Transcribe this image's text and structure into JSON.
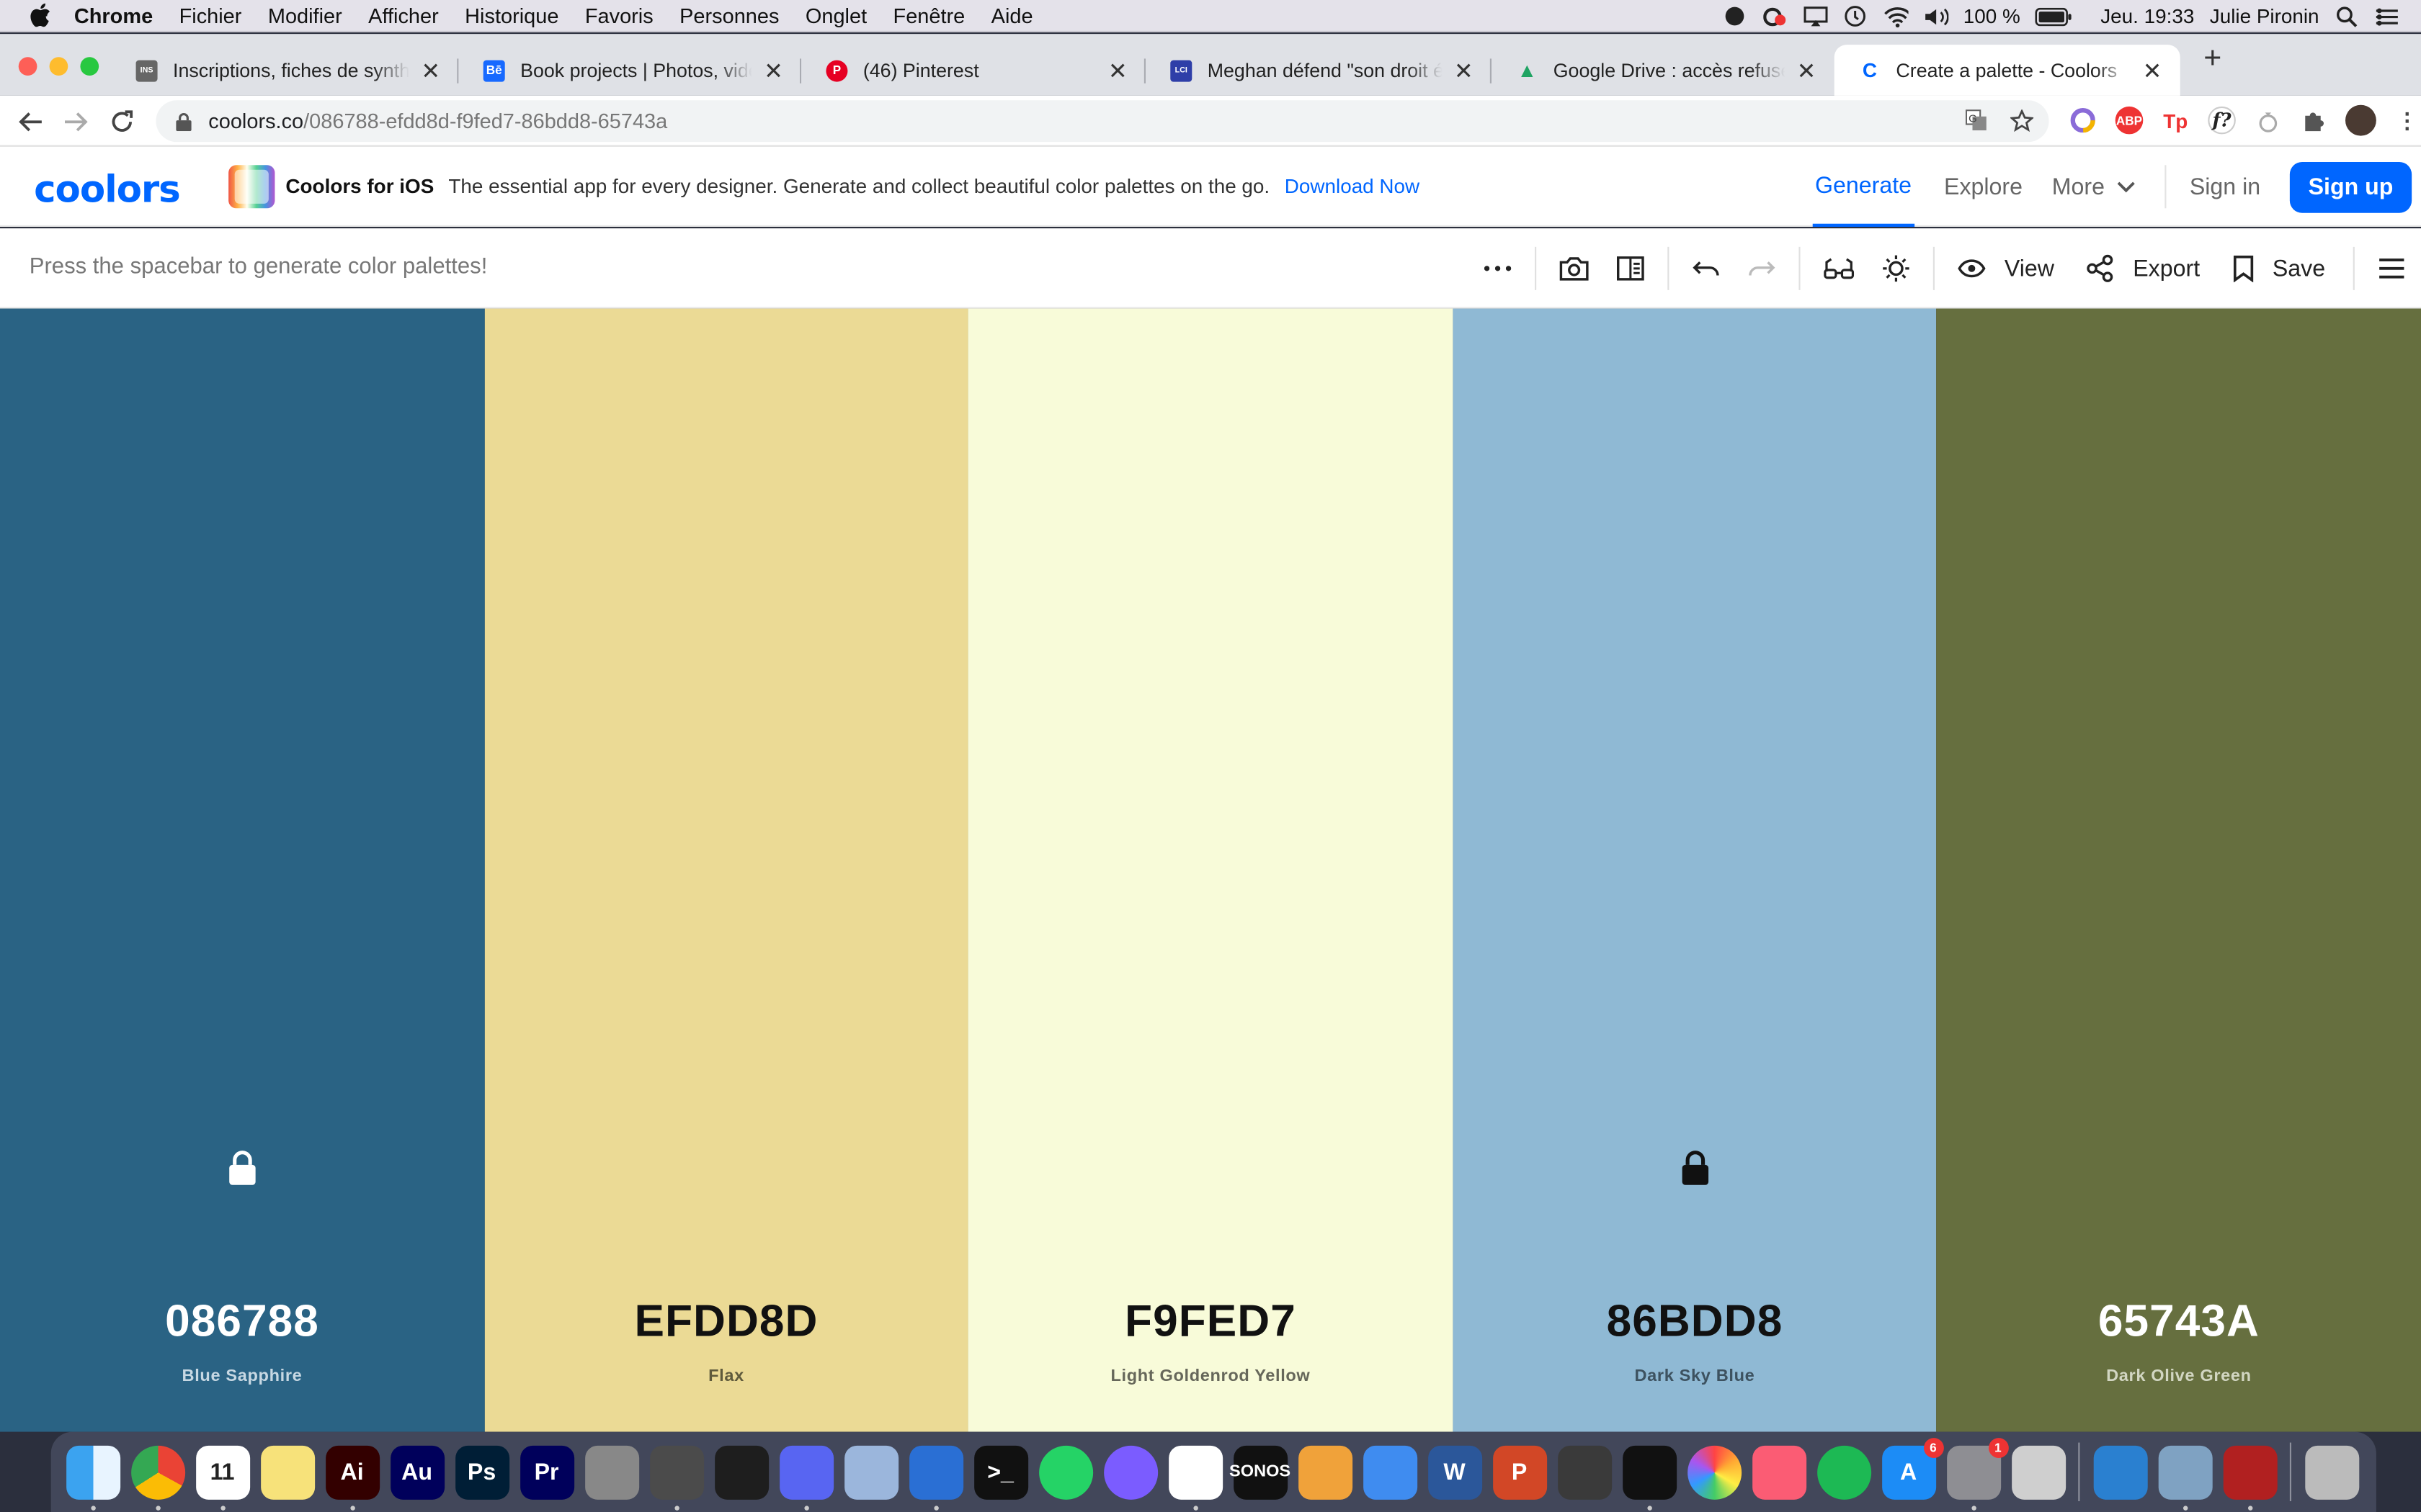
{
  "menubar": {
    "app": "Chrome",
    "items": [
      "Fichier",
      "Modifier",
      "Afficher",
      "Historique",
      "Favoris",
      "Personnes",
      "Onglet",
      "Fenêtre",
      "Aide"
    ],
    "battery": "100 %",
    "clock": "Jeu. 19:33",
    "user": "Julie Pironin"
  },
  "tabs": [
    {
      "title": "Inscriptions, fiches de synthèse",
      "favicon_color": "#666",
      "favicon_text": "INS"
    },
    {
      "title": "Book projects | Photos, vidéos",
      "favicon_color": "#1769ff",
      "favicon_text": "Bē"
    },
    {
      "title": "(46) Pinterest",
      "favicon_color": "#e60023",
      "favicon_text": "P"
    },
    {
      "title": "Meghan défend \"son droit élém",
      "favicon_color": "#2e3ea8",
      "favicon_text": "LCI"
    },
    {
      "title": "Google Drive : accès refusé",
      "favicon_color": "#1fa463",
      "favicon_text": "▲"
    },
    {
      "title": "Create a palette - Coolors",
      "favicon_color": "#0066ff",
      "favicon_text": "C"
    }
  ],
  "address": {
    "domain": "coolors.co",
    "path": "/086788-efdd8d-f9fed7-86bdd8-65743a"
  },
  "header": {
    "logo": "coolors",
    "promo_title": "Coolors for iOS",
    "promo_text": "The essential app for every designer. Generate and collect beautiful color palettes on the go.",
    "promo_link": "Download Now",
    "nav": {
      "generate": "Generate",
      "explore": "Explore",
      "more": "More",
      "signin": "Sign in",
      "signup": "Sign up"
    }
  },
  "toolbar": {
    "hint": "Press the spacebar to generate color palettes!",
    "view": "View",
    "export": "Export",
    "save": "Save"
  },
  "palette": [
    {
      "hex": "086788",
      "name": "Blue Sapphire",
      "bg": "#2a6384",
      "fg": "#ffffff",
      "sub": "#c7d8e3",
      "locked": true
    },
    {
      "hex": "EFDD8D",
      "name": "Flax",
      "bg": "#ebda95",
      "fg": "#111111",
      "sub": "#5f5a3c",
      "locked": false
    },
    {
      "hex": "F9FED7",
      "name": "Light Goldenrod Yellow",
      "bg": "#f8fbd9",
      "fg": "#111111",
      "sub": "#66675a",
      "locked": false
    },
    {
      "hex": "86BDD8",
      "name": "Dark Sky Blue",
      "bg": "#8fb9d4",
      "fg": "#111111",
      "sub": "#3d5260",
      "locked": true
    },
    {
      "hex": "65743A",
      "name": "Dark Olive Green",
      "bg": "#666f3f",
      "fg": "#ffffff",
      "sub": "#d2d6c2",
      "locked": false
    }
  ],
  "dock": [
    {
      "name": "finder",
      "color": "#3ba3f0",
      "label": ""
    },
    {
      "name": "chrome",
      "color": "#ffffff",
      "label": ""
    },
    {
      "name": "calendar",
      "color": "#ffffff",
      "label": "11"
    },
    {
      "name": "notes",
      "color": "#f7e27a",
      "label": ""
    },
    {
      "name": "illustrator",
      "color": "#330000",
      "label": "Ai"
    },
    {
      "name": "audition",
      "color": "#00005b",
      "label": "Au"
    },
    {
      "name": "photoshop",
      "color": "#001e36",
      "label": "Ps"
    },
    {
      "name": "premiere",
      "color": "#00005b",
      "label": "Pr"
    },
    {
      "name": "silverlock",
      "color": "#888",
      "label": ""
    },
    {
      "name": "sublime",
      "color": "#4b4b4b",
      "label": ""
    },
    {
      "name": "figma",
      "color": "#1e1e1e",
      "label": ""
    },
    {
      "name": "discord",
      "color": "#5865f2",
      "label": ""
    },
    {
      "name": "virtualbox",
      "color": "#9bb6dc",
      "label": ""
    },
    {
      "name": "shark",
      "color": "#2a6fd4",
      "label": ""
    },
    {
      "name": "terminal",
      "color": "#111111",
      "label": ">_"
    },
    {
      "name": "whatsapp",
      "color": "#25d366",
      "label": ""
    },
    {
      "name": "messenger",
      "color": "#7b5cff",
      "label": ""
    },
    {
      "name": "slack",
      "color": "#ffffff",
      "label": ""
    },
    {
      "name": "sonos",
      "color": "#111111",
      "label": "SONOS"
    },
    {
      "name": "pages",
      "color": "#f0a23a",
      "label": ""
    },
    {
      "name": "keynote",
      "color": "#3f8cf0",
      "label": ""
    },
    {
      "name": "word",
      "color": "#2b579a",
      "label": "W"
    },
    {
      "name": "powerpoint",
      "color": "#d24726",
      "label": "P"
    },
    {
      "name": "printer",
      "color": "#3a3a3a",
      "label": ""
    },
    {
      "name": "acrobat",
      "color": "#111111",
      "label": ""
    },
    {
      "name": "photos",
      "color": "#ffffff",
      "label": ""
    },
    {
      "name": "music",
      "color": "#fb5c74",
      "label": ""
    },
    {
      "name": "spotify",
      "color": "#1db954",
      "label": ""
    },
    {
      "name": "appstore",
      "color": "#1c8cf6",
      "label": "A",
      "badge": "6"
    },
    {
      "name": "preferences",
      "color": "#8e8e93",
      "label": "",
      "badge": "1"
    },
    {
      "name": "installer",
      "color": "#cfcfcf",
      "label": ""
    },
    {
      "name": "vscode",
      "color": "#2a80d0",
      "label": ""
    },
    {
      "name": "preview",
      "color": "#7fa2c2",
      "label": ""
    },
    {
      "name": "photobooth",
      "color": "#b12020",
      "label": ""
    },
    {
      "name": "trash",
      "color": "#bbbbbb",
      "label": ""
    }
  ]
}
